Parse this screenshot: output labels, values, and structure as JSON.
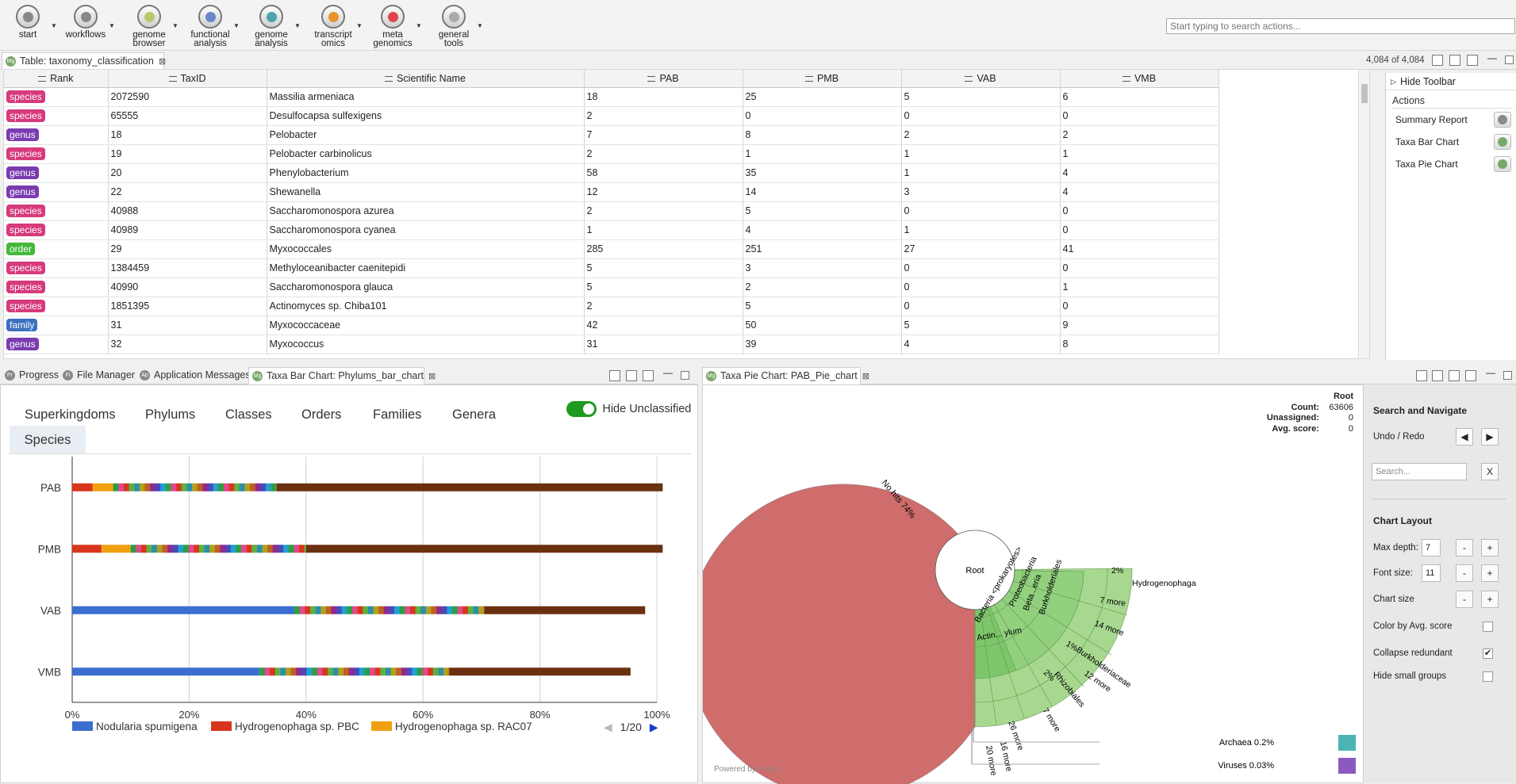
{
  "toolbar": {
    "buttons": [
      {
        "label": "start",
        "color": "#888888"
      },
      {
        "label": "workflows",
        "color": "#888888"
      },
      {
        "label": "genome\nbrowser",
        "color": "#b9c96a"
      },
      {
        "label": "functional\nanalysis",
        "color": "#6a86c8"
      },
      {
        "label": "genome\nanalysis",
        "color": "#4aa3b0"
      },
      {
        "label": "transcript\nomics",
        "color": "#e8922c"
      },
      {
        "label": "meta\ngenomics",
        "color": "#e0454a"
      },
      {
        "label": "general\ntools",
        "color": "#aaaaaa"
      }
    ],
    "search_placeholder": "Start typing to search actions..."
  },
  "table_tab": {
    "title": "Table: taxonomy_classification",
    "count": "4,084 of 4,084"
  },
  "table": {
    "columns": [
      "Rank",
      "TaxID",
      "Scientific Name",
      "PAB",
      "PMB",
      "VAB",
      "VMB"
    ],
    "rows": [
      [
        "species",
        "2072590",
        "Massilia armeniaca",
        "18",
        "25",
        "5",
        "6"
      ],
      [
        "species",
        "65555",
        "Desulfocapsa sulfexigens",
        "2",
        "0",
        "0",
        "0"
      ],
      [
        "genus",
        "18",
        "Pelobacter",
        "7",
        "8",
        "2",
        "2"
      ],
      [
        "species",
        "19",
        "Pelobacter carbinolicus",
        "2",
        "1",
        "1",
        "1"
      ],
      [
        "genus",
        "20",
        "Phenylobacterium",
        "58",
        "35",
        "1",
        "4"
      ],
      [
        "genus",
        "22",
        "Shewanella",
        "12",
        "14",
        "3",
        "4"
      ],
      [
        "species",
        "40988",
        "Saccharomonospora azurea",
        "2",
        "5",
        "0",
        "0"
      ],
      [
        "species",
        "40989",
        "Saccharomonospora cyanea",
        "1",
        "4",
        "1",
        "0"
      ],
      [
        "order",
        "29",
        "Myxococcales",
        "285",
        "251",
        "27",
        "41"
      ],
      [
        "species",
        "1384459",
        "Methyloceanibacter caenitepidi",
        "5",
        "3",
        "0",
        "0"
      ],
      [
        "species",
        "40990",
        "Saccharomonospora glauca",
        "5",
        "2",
        "0",
        "1"
      ],
      [
        "species",
        "1851395",
        "Actinomyces sp. Chiba101",
        "2",
        "5",
        "0",
        "0"
      ],
      [
        "family",
        "31",
        "Myxococcaceae",
        "42",
        "50",
        "5",
        "9"
      ],
      [
        "genus",
        "32",
        "Myxococcus",
        "31",
        "39",
        "4",
        "8"
      ]
    ],
    "rank_colors": {
      "species": "#d63a7c",
      "genus": "#7a3bb0",
      "order": "#43b83b",
      "family": "#3c6fc0"
    }
  },
  "side": {
    "hide_toolbar": "Hide Toolbar",
    "actions_title": "Actions",
    "actions": [
      "Summary Report",
      "Taxa Bar Chart",
      "Taxa Pie Chart"
    ]
  },
  "bottom_tabs": [
    "Progress",
    "File Manager",
    "Application Messages",
    "Taxa Bar Chart: Phylums_bar_chart"
  ],
  "pie_tab": "Taxa Pie Chart: PAB_Pie_chart",
  "bar": {
    "rank_tabs": [
      "Superkingdoms",
      "Phylums",
      "Classes",
      "Orders",
      "Families",
      "Genera",
      "Species"
    ],
    "hide_unclassified": "Hide Unclassified",
    "legend": [
      {
        "name": "Nodularia spumigena",
        "color": "#3a6fd0"
      },
      {
        "name": "Hydrogenophaga sp. PBC",
        "color": "#d8361c"
      },
      {
        "name": "Hydrogenophaga sp. RAC07",
        "color": "#f0a010"
      }
    ],
    "page": "1/20"
  },
  "chart_data": {
    "type": "bar",
    "orientation": "horizontal-stacked-percent",
    "categories": [
      "PAB",
      "PMB",
      "VAB",
      "VMB"
    ],
    "x_ticks": [
      "0%",
      "20%",
      "40%",
      "60%",
      "80%",
      "100%"
    ],
    "xlim": [
      0,
      100
    ],
    "series": [
      {
        "name": "Nodularia spumigena",
        "color": "#3a6fd0",
        "values": [
          0,
          0,
          38,
          32
        ]
      },
      {
        "name": "Hydrogenophaga sp. PBC",
        "color": "#d8361c",
        "values": [
          3.5,
          5,
          0,
          0
        ]
      },
      {
        "name": "Hydrogenophaga sp. RAC07",
        "color": "#f0a010",
        "values": [
          3.5,
          5,
          0,
          0
        ]
      },
      {
        "color": "#2e9e42",
        "values": [
          1.5,
          1.5,
          3,
          3
        ]
      },
      {
        "color": "#8e2b8e",
        "values": [
          1.5,
          1.5,
          2.5,
          2
        ]
      },
      {
        "color": "#2c8fa8",
        "values": [
          1.5,
          1.5,
          2,
          2
        ]
      },
      {
        "color": "#e04a8a",
        "values": [
          1.5,
          1.5,
          2,
          1.5
        ]
      },
      {
        "color": "#4a4ab8",
        "values": [
          1.5,
          1.5,
          2,
          1.5
        ]
      },
      {
        "color": "#b0a020",
        "values": [
          1.5,
          1.5,
          2,
          1.5
        ]
      },
      {
        "color": "#7a4a1a",
        "values": [
          19,
          21,
          19,
          21
        ]
      },
      {
        "color": "#6b3010",
        "values": [
          66,
          61,
          27.5,
          31
        ]
      }
    ]
  },
  "pie": {
    "root": "Root",
    "count_label": "Count:",
    "count": "63606",
    "unassigned_label": "Unassigned:",
    "unassigned": "0",
    "avg_label": "Avg. score:",
    "avg": "0",
    "no_hits": "No hits",
    "no_hits_pct": "74%",
    "center": "Root",
    "labels": [
      "Bacteria <prokaryotes>",
      "Proteobacteria",
      "Beta...eria",
      "Burkholderiales",
      "Burkholderiaceae",
      "Hydrogenophaga",
      "Actin... ylum",
      "Rhizobiales",
      "7 more",
      "14 more",
      "12 more",
      "7 more",
      "26 more",
      "16 more",
      "20 more",
      "2%",
      "1%",
      "2%"
    ],
    "archaea": "Archaea",
    "archaea_pct": "0.2%",
    "viruses": "Viruses",
    "viruses_pct": "0.03%",
    "powered": "Powered by Krona",
    "colors": {
      "nohits": "#cf6c6c",
      "green": "#7dc56a",
      "archaea": "#4bb5b5",
      "viruses": "#8a5ac0"
    }
  },
  "krona": {
    "search_nav": "Search and Navigate",
    "undo_redo": "Undo / Redo",
    "search_placeholder": "Search...",
    "clear": "X",
    "layout": "Chart Layout",
    "max_depth": "Max depth:",
    "max_depth_val": "7",
    "font_size": "Font size:",
    "font_size_val": "11",
    "chart_size": "Chart size",
    "color_by": "Color by Avg. score",
    "collapse": "Collapse redundant",
    "hide_small": "Hide small groups",
    "minus": "-",
    "plus": "+"
  }
}
